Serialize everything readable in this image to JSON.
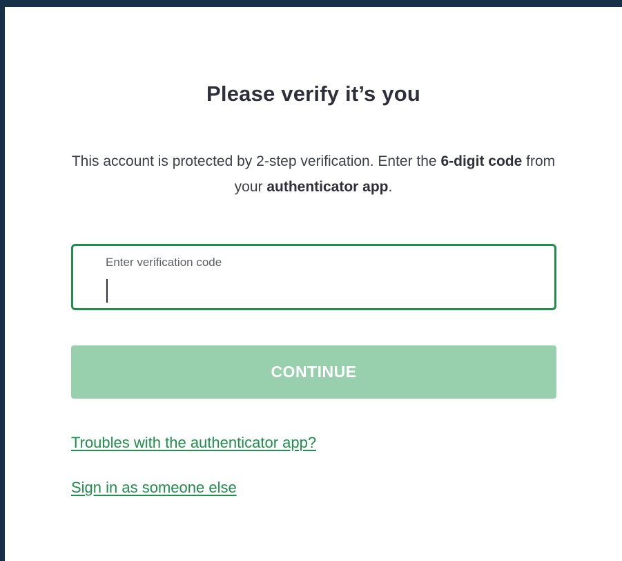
{
  "page": {
    "title": "Please verify it’s you",
    "description": {
      "part1": "This account is protected by 2-step verification. Enter the ",
      "bold1": "6-digit code",
      "part2": " from your ",
      "bold2": "authenticator app",
      "part3": "."
    }
  },
  "form": {
    "code_label": "Enter verification code",
    "code_value": "",
    "continue_label": "CONTINUE"
  },
  "links": {
    "troubles": "Troubles with the authenticator app?",
    "sign_in_other": "Sign in as someone else"
  },
  "colors": {
    "background": "#163047",
    "accent": "#1e8f4a",
    "button_disabled": "#98d0ad"
  }
}
